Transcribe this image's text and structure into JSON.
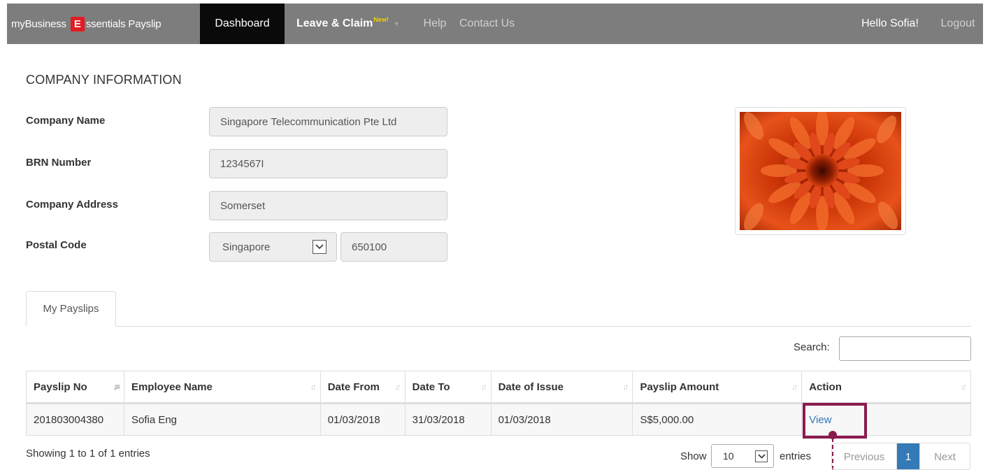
{
  "navbar": {
    "brand_prefix": "myBusiness",
    "brand_e": "E",
    "brand_suffix": "ssentials Payslip",
    "items": {
      "dashboard": "Dashboard",
      "leave": "Leave & Claim",
      "leave_badge": "New!",
      "help": "Help",
      "contact": "Contact Us"
    },
    "greeting": "Hello Sofia!",
    "logout": "Logout"
  },
  "company": {
    "section_title": "COMPANY INFORMATION",
    "fields": {
      "name_label": "Company Name",
      "name_value": "Singapore Telecommunication Pte Ltd",
      "brn_label": "BRN Number",
      "brn_value": "1234567I",
      "address_label": "Company Address",
      "address_value": "Somerset",
      "postal_label": "Postal Code",
      "country_value": "Singapore",
      "postal_value": "650100"
    },
    "logo_icon": "chrysanthemum-photo"
  },
  "payslips": {
    "tab_label": "My Payslips",
    "search_label": "Search:",
    "search_value": "",
    "columns": [
      "Payslip No",
      "Employee Name",
      "Date From",
      "Date To",
      "Date of Issue",
      "Payslip Amount",
      "Action"
    ],
    "rows": [
      {
        "payslip_no": "201803004380",
        "employee_name": "Sofia Eng",
        "date_from": "01/03/2018",
        "date_to": "31/03/2018",
        "date_of_issue": "01/03/2018",
        "amount": "S$5,000.00",
        "action": "View"
      }
    ],
    "showing_text": "Showing 1 to 1 of 1 entries",
    "show_label": "Show",
    "page_size": "10",
    "entries_label": "entries",
    "pagination": {
      "previous": "Previous",
      "current": "1",
      "next": "Next"
    }
  },
  "colors": {
    "navbar": "#7d7d7d",
    "active_nav": "#0a0a0a",
    "brand_red": "#e31b23",
    "link_blue": "#337ab7",
    "callout": "#8b1a4f"
  }
}
